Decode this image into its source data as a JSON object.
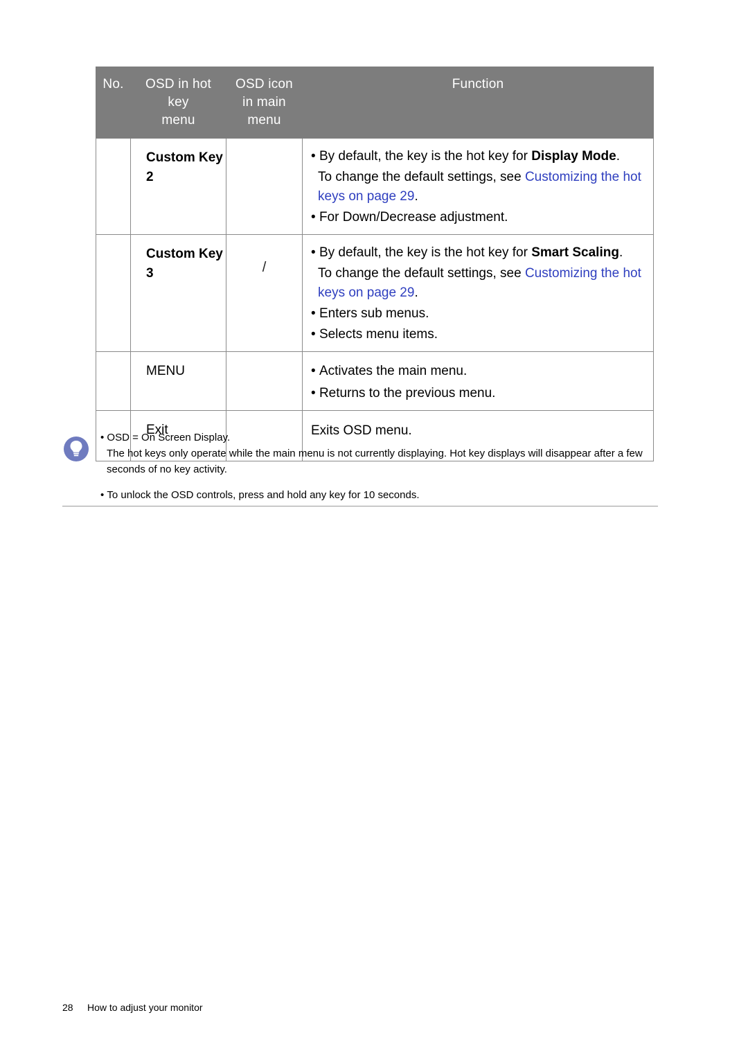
{
  "table": {
    "headers": {
      "no": "No.",
      "hotkey_menu": "OSD in hot key\nmenu",
      "osd_icon": "OSD icon\nin main\nmenu",
      "function": "Function"
    },
    "header_lines": {
      "no": "No.",
      "hotkey_line1": "OSD in hot key",
      "hotkey_line2": "menu",
      "icon_line1": "OSD icon",
      "icon_line2": "in main",
      "icon_line3": "menu",
      "function": "Function"
    },
    "rows": [
      {
        "no": "",
        "key_label": "Custom Key 2",
        "icon": "",
        "lines": [
          "By default, the key is the hot key for Display Mode.",
          "To change the default settings, see Customizing the hot keys on page 29.",
          "For Down/Decrease adjustment."
        ],
        "line1_pre": "By default, the key is the hot key for ",
        "line1_bold": "Display Mode",
        "line1_post": ".",
        "line2_pre": "To change the default settings, see ",
        "line2_link": "Customizing the hot keys on page 29",
        "line2_post": ".",
        "line3": "For Down/Decrease adjustment."
      },
      {
        "no": "",
        "key_label": "Custom Key 3",
        "icon": "/",
        "lines": [
          "By default, the key is the hot key for Smart Scaling.",
          "To change the default settings, see Customizing the hot keys on page 29.",
          "Enters sub menus.",
          "Selects menu items."
        ],
        "line1_pre": "By default, the key is the hot key for ",
        "line1_bold": "Smart Scaling",
        "line1_post": ".",
        "line2_pre": "To change the default settings, see ",
        "line2_link": "Customizing the hot keys on page 29",
        "line2_post": ".",
        "line3": "Enters sub menus.",
        "line4": "Selects menu items."
      },
      {
        "no": "",
        "key_label": "MENU",
        "icon": "",
        "line1": "Activates the main menu.",
        "line2": "Returns to the previous menu."
      },
      {
        "no": "",
        "key_label": "Exit",
        "icon": "",
        "line1": "Exits OSD menu."
      }
    ]
  },
  "note": {
    "icon_name": "lightbulb-icon",
    "bullet1": "OSD = On Screen Display.",
    "bullet1_sub": "The hot keys only operate while the main menu is not currently displaying. Hot key displays will disappear after a few seconds of no key activity.",
    "bullet2": "To unlock the OSD controls, press and hold any key for 10 seconds."
  },
  "footer": {
    "page_number": "28",
    "chapter": "How to adjust your monitor"
  }
}
